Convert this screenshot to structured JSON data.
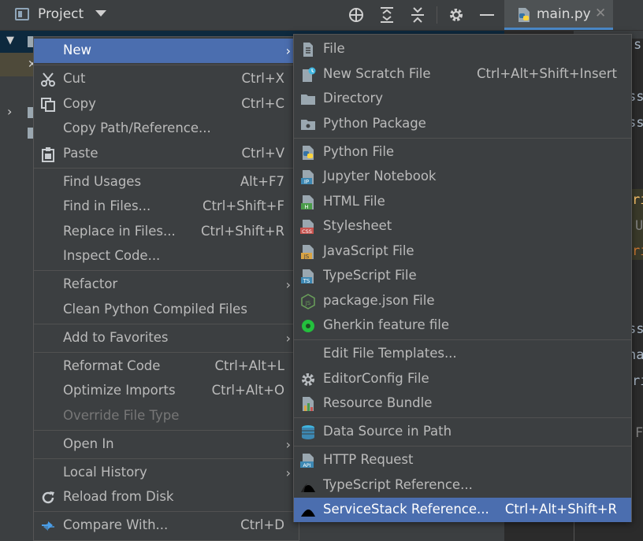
{
  "toolbar": {
    "project_label": "Project",
    "tab_label": "main.py",
    "tab_close": "✕"
  },
  "editor": {
    "fragments": [
      "s",
      "ss",
      "ss",
      "ri",
      "U",
      "ri",
      "ss",
      "na",
      "ri",
      "F"
    ]
  },
  "context_menu": {
    "items": [
      {
        "label": "New",
        "has_submenu": true,
        "highlighted": true
      },
      {
        "label": "Cut",
        "shortcut": "Ctrl+X",
        "icon": "scissors-icon"
      },
      {
        "label": "Copy",
        "shortcut": "Ctrl+C",
        "icon": "copy-icon"
      },
      {
        "label": "Copy Path/Reference..."
      },
      {
        "label": "Paste",
        "shortcut": "Ctrl+V",
        "icon": "clipboard-icon"
      },
      {
        "label": "Find Usages",
        "shortcut": "Alt+F7"
      },
      {
        "label": "Find in Files...",
        "shortcut": "Ctrl+Shift+F"
      },
      {
        "label": "Replace in Files...",
        "shortcut": "Ctrl+Shift+R"
      },
      {
        "label": "Inspect Code..."
      },
      {
        "label": "Refactor",
        "has_submenu": true
      },
      {
        "label": "Clean Python Compiled Files"
      },
      {
        "label": "Add to Favorites",
        "has_submenu": true
      },
      {
        "label": "Reformat Code",
        "shortcut": "Ctrl+Alt+L"
      },
      {
        "label": "Optimize Imports",
        "shortcut": "Ctrl+Alt+O"
      },
      {
        "label": "Override File Type",
        "disabled": true
      },
      {
        "label": "Open In",
        "has_submenu": true
      },
      {
        "label": "Local History",
        "has_submenu": true
      },
      {
        "label": "Reload from Disk",
        "icon": "reload-icon"
      },
      {
        "label": "Compare With...",
        "shortcut": "Ctrl+D",
        "icon": "compare-icon"
      }
    ]
  },
  "new_submenu": {
    "items": [
      {
        "label": "File",
        "icon": "file-icon"
      },
      {
        "label": "New Scratch File",
        "shortcut": "Ctrl+Alt+Shift+Insert",
        "icon": "scratch-file-icon"
      },
      {
        "label": "Directory",
        "icon": "folder-icon"
      },
      {
        "label": "Python Package",
        "icon": "package-icon"
      },
      {
        "label": "Python File",
        "icon": "python-file-icon"
      },
      {
        "label": "Jupyter Notebook",
        "icon": "jupyter-icon",
        "badge": "IP"
      },
      {
        "label": "HTML File",
        "icon": "html-file-icon",
        "badge": "H"
      },
      {
        "label": "Stylesheet",
        "icon": "css-file-icon",
        "badge": "CSS"
      },
      {
        "label": "JavaScript File",
        "icon": "js-file-icon",
        "badge": "JS"
      },
      {
        "label": "TypeScript File",
        "icon": "ts-file-icon",
        "badge": "TS"
      },
      {
        "label": "package.json File",
        "icon": "nodejs-icon",
        "badge": "JS"
      },
      {
        "label": "Gherkin feature file",
        "icon": "gherkin-icon"
      },
      {
        "label": "Edit File Templates..."
      },
      {
        "label": "EditorConfig File",
        "icon": "gear-icon"
      },
      {
        "label": "Resource Bundle",
        "icon": "resource-bundle-icon"
      },
      {
        "label": "Data Source in Path",
        "icon": "database-icon"
      },
      {
        "label": "HTTP Request",
        "icon": "api-icon",
        "badge": "API"
      },
      {
        "label": "TypeScript Reference...",
        "icon": "servicestack-icon"
      },
      {
        "label": "ServiceStack Reference...",
        "shortcut": "Ctrl+Alt+Shift+R",
        "icon": "servicestack-icon",
        "highlighted": true
      }
    ]
  },
  "colors": {
    "menu_bg": "#3c3f41",
    "highlight": "#4b6eaf",
    "text": "#bbbbbb",
    "disabled_text": "#777777"
  }
}
